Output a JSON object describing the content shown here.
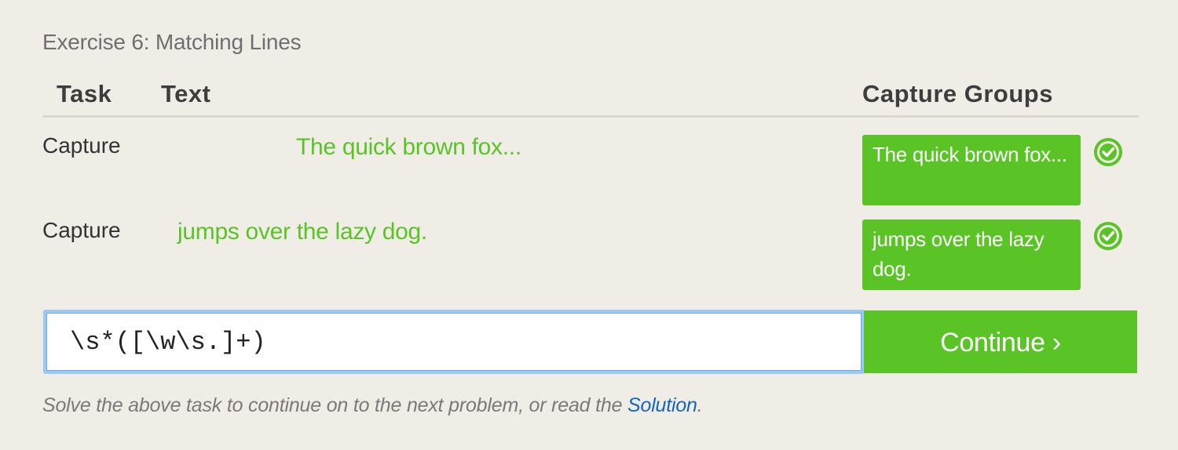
{
  "exercise": {
    "title": "Exercise 6: Matching Lines"
  },
  "table": {
    "headers": {
      "task": "Task",
      "text": "Text",
      "capture_groups": "Capture Groups"
    },
    "rows": [
      {
        "task": "Capture",
        "text": "The quick brown fox...",
        "capture_group": "The quick brown fox...",
        "status_icon": "check-circle-icon"
      },
      {
        "task": "Capture",
        "text": "jumps over the lazy dog.",
        "capture_group": "jumps over the lazy dog.",
        "status_icon": "check-circle-icon"
      }
    ]
  },
  "input": {
    "value": "\\s*([\\w\\s.]+)"
  },
  "continue_button": {
    "label": "Continue ›"
  },
  "footer": {
    "prefix": "Solve the above task to continue on to the next problem, or read the ",
    "link_label": "Solution",
    "suffix": "."
  },
  "colors": {
    "background": "#efede6",
    "accent_green": "#5ac426",
    "link_blue": "#1565c0",
    "input_focus_border": "#9cc8f4"
  }
}
